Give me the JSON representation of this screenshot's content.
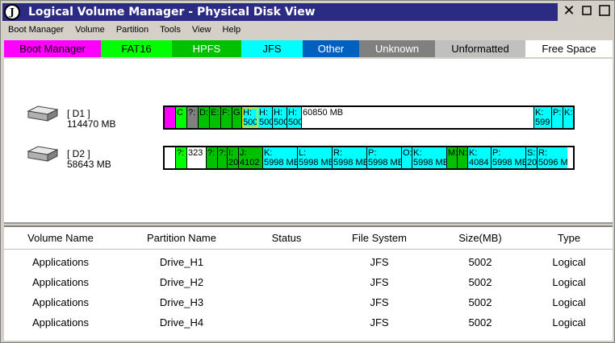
{
  "window": {
    "title": "Logical Volume Manager - Physical Disk View",
    "icon_letter": "J"
  },
  "menu": [
    "Boot Manager",
    "Volume",
    "Partition",
    "Tools",
    "View",
    "Help"
  ],
  "legend": [
    {
      "label": "Boot Manager",
      "bg": "#ff00ff",
      "fg": "#000000"
    },
    {
      "label": "FAT16",
      "bg": "#00ff00",
      "fg": "#000000"
    },
    {
      "label": "HPFS",
      "bg": "#00c000",
      "fg": "#ffffff"
    },
    {
      "label": "JFS",
      "bg": "#00ffff",
      "fg": "#000000"
    },
    {
      "label": "Other",
      "bg": "#0060c0",
      "fg": "#ffffff"
    },
    {
      "label": "Unknown",
      "bg": "#808080",
      "fg": "#ffffff"
    },
    {
      "label": "Unformatted",
      "bg": "#c0c0c0",
      "fg": "#000000"
    },
    {
      "label": "Free Space",
      "bg": "#ffffff",
      "fg": "#000000"
    }
  ],
  "disks": [
    {
      "name": "[ D1 ]",
      "size": "114470 MB",
      "segments": [
        {
          "l1": "",
          "l2": "",
          "type": "boot",
          "w": 14
        },
        {
          "l1": "C",
          "l2": "",
          "type": "fat16",
          "w": 14
        },
        {
          "l1": "?:",
          "l2": "",
          "type": "unknown",
          "w": 14
        },
        {
          "l1": "D:",
          "l2": "",
          "type": "hpfs",
          "w": 14
        },
        {
          "l1": "E:",
          "l2": "",
          "type": "hpfs",
          "w": 14
        },
        {
          "l1": "F:",
          "l2": "",
          "type": "hpfs",
          "w": 14
        },
        {
          "l1": "G",
          "l2": "",
          "type": "hpfs",
          "w": 12
        },
        {
          "l1": "H:",
          "l2": "500",
          "type": "jfs",
          "w": 20,
          "selected": true
        },
        {
          "l1": "H:",
          "l2": "500",
          "type": "jfs",
          "w": 18
        },
        {
          "l1": "H:",
          "l2": "500",
          "type": "jfs",
          "w": 18
        },
        {
          "l1": "H:",
          "l2": "500",
          "type": "jfs",
          "w": 18
        },
        {
          "l1": "",
          "l2": "60850 MB",
          "type": "free",
          "w": 288
        },
        {
          "l1": "K:",
          "l2": "599",
          "type": "jfs",
          "w": 22
        },
        {
          "l1": "P:",
          "l2": "",
          "type": "jfs",
          "w": 14
        },
        {
          "l1": "K:",
          "l2": "",
          "type": "jfs",
          "w": 14
        }
      ]
    },
    {
      "name": "[ D2 ]",
      "size": "58643 MB",
      "segments": [
        {
          "l1": "",
          "l2": "",
          "type": "free",
          "w": 14
        },
        {
          "l1": "?:",
          "l2": "",
          "type": "fat16",
          "w": 14
        },
        {
          "l1": "",
          "l2": "323",
          "type": "free",
          "w": 24
        },
        {
          "l1": "?:",
          "l2": "",
          "type": "hpfs",
          "w": 14
        },
        {
          "l1": "?:",
          "l2": "",
          "type": "hpfs",
          "w": 12
        },
        {
          "l1": "I:",
          "l2": "204",
          "type": "hpfs",
          "w": 14
        },
        {
          "l1": "J:",
          "l2": "4102",
          "type": "hpfs",
          "w": 30
        },
        {
          "l1": "K:",
          "l2": "5998 MB",
          "type": "jfs",
          "w": 43
        },
        {
          "l1": "L:",
          "l2": "5998 MB",
          "type": "jfs",
          "w": 43
        },
        {
          "l1": "R:",
          "l2": "5998 MB",
          "type": "jfs",
          "w": 43
        },
        {
          "l1": "P:",
          "l2": "5998 MB",
          "type": "jfs",
          "w": 43
        },
        {
          "l1": "O:",
          "l2": "",
          "type": "jfs",
          "w": 13
        },
        {
          "l1": "K:",
          "l2": "5998 MB",
          "type": "jfs",
          "w": 43
        },
        {
          "l1": "M:",
          "l2": "",
          "type": "hpfs",
          "w": 13
        },
        {
          "l1": "N:",
          "l2": "",
          "type": "hpfs",
          "w": 13
        },
        {
          "l1": "K:",
          "l2": "4084",
          "type": "jfs",
          "w": 29
        },
        {
          "l1": "P:",
          "l2": "5998 MB",
          "type": "jfs",
          "w": 43
        },
        {
          "l1": "S:",
          "l2": "20",
          "type": "jfs",
          "w": 14
        },
        {
          "l1": "R:",
          "l2": "5096 M",
          "type": "jfs",
          "w": 37
        }
      ]
    }
  ],
  "table": {
    "headers": [
      "Volume Name",
      "Partition Name",
      "Status",
      "File System",
      "Size(MB)",
      "Type"
    ],
    "rows": [
      [
        "Applications",
        "Drive_H1",
        "",
        "JFS",
        "5002",
        "Logical"
      ],
      [
        "Applications",
        "Drive_H2",
        "",
        "JFS",
        "5002",
        "Logical"
      ],
      [
        "Applications",
        "Drive_H3",
        "",
        "JFS",
        "5002",
        "Logical"
      ],
      [
        "Applications",
        "Drive_H4",
        "",
        "JFS",
        "5002",
        "Logical"
      ]
    ]
  },
  "colors": {
    "boot": "#ff00ff",
    "fat16": "#00ff00",
    "hpfs": "#00c000",
    "jfs": "#00ffff",
    "unknown": "#808080",
    "free": "#ffffff"
  }
}
